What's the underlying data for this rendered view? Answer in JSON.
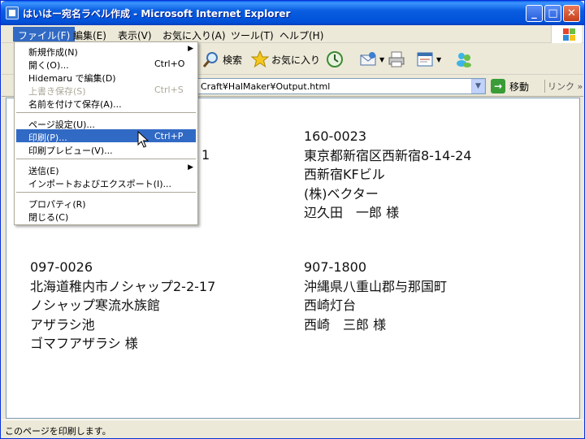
{
  "window": {
    "title": "はいはー宛名ラベル作成 - Microsoft Internet Explorer"
  },
  "menubar": {
    "items": [
      {
        "label": "ファイル(F)"
      },
      {
        "label": "編集(E)"
      },
      {
        "label": "表示(V)"
      },
      {
        "label": "お気に入り(A)"
      },
      {
        "label": "ツール(T)"
      },
      {
        "label": "ヘルプ(H)"
      }
    ]
  },
  "toolbar": {
    "search_label": "検索",
    "favorites_label": "お気に入り"
  },
  "address": {
    "url_fragment": "Craft¥HalMaker¥Output.html",
    "go_label": "移動",
    "links_label": "リンク"
  },
  "file_menu": {
    "items": [
      {
        "label": "新規作成(N)",
        "shortcut": "",
        "submenu": true
      },
      {
        "label": "開く(O)...",
        "shortcut": "Ctrl+O"
      },
      {
        "label": "Hidemaru で編集(D)",
        "shortcut": ""
      },
      {
        "label": "上書き保存(S)",
        "shortcut": "Ctrl+S",
        "disabled": true
      },
      {
        "label": "名前を付けて保存(A)...",
        "shortcut": ""
      },
      {
        "label": "ページ設定(U)...",
        "shortcut": ""
      },
      {
        "label": "印刷(P)...",
        "shortcut": "Ctrl+P",
        "highlighted": true
      },
      {
        "label": "印刷プレビュー(V)...",
        "shortcut": ""
      },
      {
        "label": "送信(E)",
        "shortcut": "",
        "submenu": true
      },
      {
        "label": "インポートおよびエクスポート(I)...",
        "shortcut": ""
      },
      {
        "label": "プロパティ(R)",
        "shortcut": ""
      },
      {
        "label": "閉じる(C)",
        "shortcut": ""
      }
    ]
  },
  "labels": [
    {
      "lines": [
        "1",
        "",
        "",
        ""
      ]
    },
    {
      "lines": [
        "160-0023",
        "東京都新宿区西新宿8-14-24",
        "西新宿KFビル",
        "(株)ベクター",
        "辺久田　一郎 様"
      ]
    },
    {
      "lines": [
        "097-0026",
        "北海道稚内市ノシャップ2-2-17",
        "ノシャップ寒流水族館",
        "アザラシ池",
        "ゴマフアザラシ 様"
      ]
    },
    {
      "lines": [
        "907-1800",
        "沖縄県八重山郡与那国町",
        "西崎灯台",
        "西崎　三郎 様"
      ]
    }
  ],
  "statusbar": {
    "text": "このページを印刷します。"
  },
  "colors": {
    "titlebar": "#0a5ee0",
    "menu_highlight": "#316ac5",
    "window_bg": "#ece9d8"
  },
  "icons": [
    "ie-page-icon",
    "minimize-icon",
    "maximize-icon",
    "close-icon",
    "windows-logo-icon",
    "search-icon",
    "favorites-star-icon",
    "history-icon",
    "mail-icon",
    "print-icon",
    "edit-icon",
    "messenger-icon",
    "go-arrow-icon",
    "mouse-cursor-icon"
  ]
}
